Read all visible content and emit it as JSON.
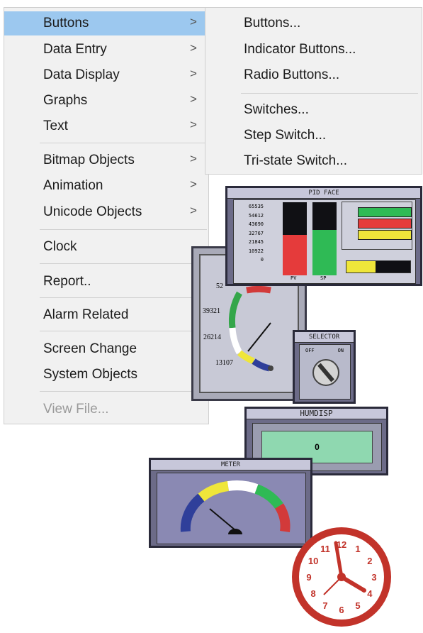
{
  "menu": {
    "items": [
      {
        "label": "Buttons",
        "arrow": ">"
      },
      {
        "label": "Data Entry",
        "arrow": ">"
      },
      {
        "label": "Data Display",
        "arrow": ">"
      },
      {
        "label": "Graphs",
        "arrow": ">"
      },
      {
        "label": "Text",
        "arrow": ">"
      },
      {
        "label": "Bitmap Objects",
        "arrow": ">"
      },
      {
        "label": "Animation",
        "arrow": ">"
      },
      {
        "label": "Unicode Objects",
        "arrow": ">"
      },
      {
        "label": "Clock",
        "arrow": ">"
      },
      {
        "label": "Report.."
      },
      {
        "label": "Alarm Related"
      },
      {
        "label": "Screen Change"
      },
      {
        "label": "System Objects"
      },
      {
        "label": "View File..."
      }
    ]
  },
  "submenu": {
    "items": [
      {
        "label": "Buttons..."
      },
      {
        "label": "Indicator Buttons..."
      },
      {
        "label": "Radio Buttons..."
      },
      {
        "label": "Switches..."
      },
      {
        "label": "Step Switch..."
      },
      {
        "label": "Tri-state Switch..."
      }
    ]
  },
  "previews": {
    "pid_face": {
      "title": "PID FACE",
      "scale": [
        "65535",
        "54612",
        "43690",
        "32767",
        "21845",
        "10922",
        "0"
      ],
      "bar_labels": [
        "PV",
        "SP"
      ],
      "levels": {
        "pv": 0.55,
        "sp": 0.62
      },
      "colors": {
        "dark": "#101014",
        "red": "#e53b3b",
        "green": "#2fba55",
        "yellow": "#efe63a"
      }
    },
    "round_gauge": {
      "ticks": [
        "52",
        "39321",
        "26214",
        "13107"
      ]
    },
    "selector": {
      "title": "SELECTOR",
      "off": "OFF",
      "on": "ON"
    },
    "humdisp": {
      "title": "HUMDISP",
      "value": "0"
    },
    "meter": {
      "title": "METER"
    },
    "clock": {
      "numerals": [
        "12",
        "1",
        "2",
        "3",
        "4",
        "5",
        "6",
        "7",
        "8",
        "9",
        "10",
        "11"
      ],
      "colors": {
        "rim": "#c2332a",
        "face": "#ffffff"
      }
    }
  }
}
